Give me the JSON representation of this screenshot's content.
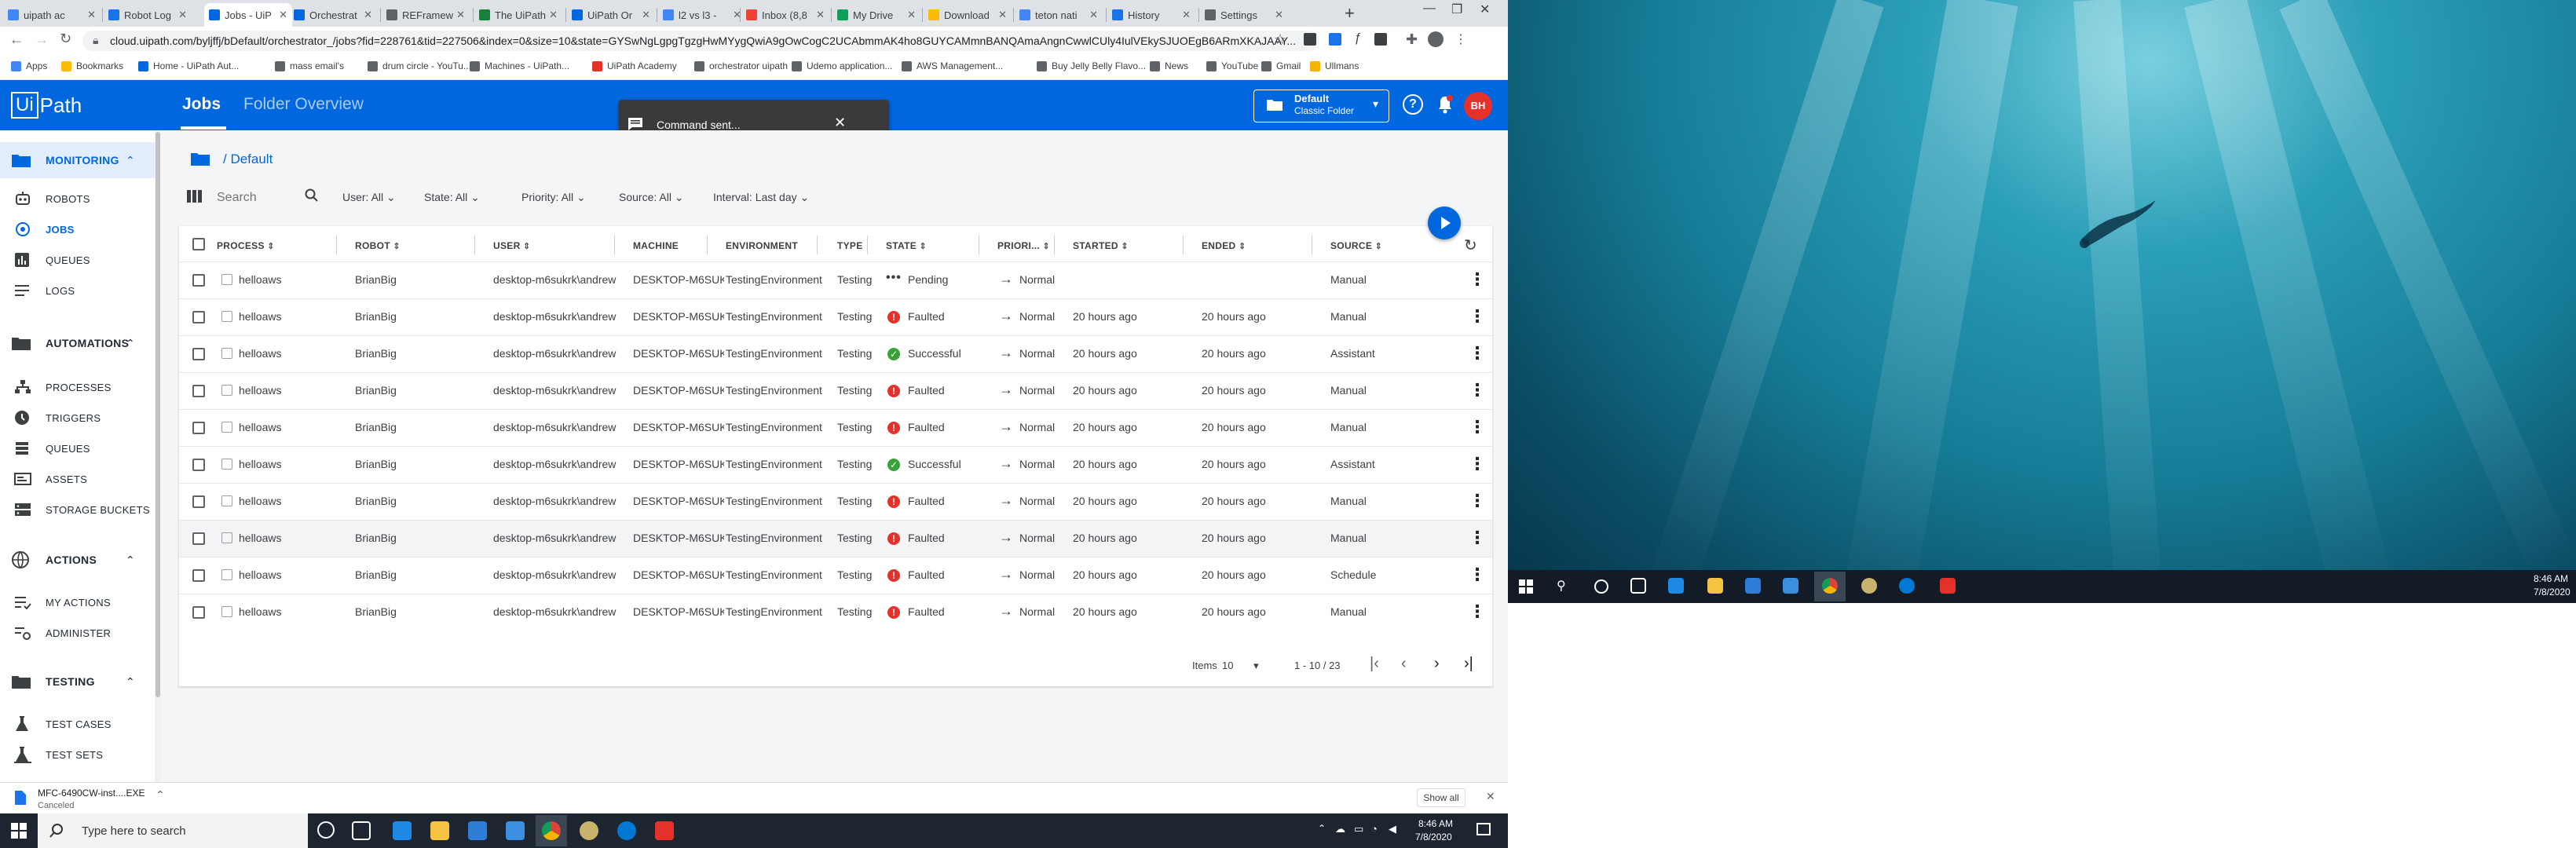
{
  "browser": {
    "tabs": [
      {
        "title": "uipath ac"
      },
      {
        "title": "Robot Log"
      },
      {
        "title": "Jobs - UiP"
      },
      {
        "title": "Orchestrat"
      },
      {
        "title": "REFramew"
      },
      {
        "title": "The UiPath"
      },
      {
        "title": "UiPath Or"
      },
      {
        "title": "l2 vs l3 - "
      },
      {
        "title": "Inbox (8,8"
      },
      {
        "title": "My Drive"
      },
      {
        "title": "Download"
      },
      {
        "title": "teton nati"
      },
      {
        "title": "History"
      },
      {
        "title": "Settings"
      }
    ],
    "new_tab": "+",
    "url": "cloud.uipath.com/byljffj/bDefault/orchestrator_/jobs?fid=228761&tid=227506&index=0&size=10&state=GYSwNgLgpgTgzgHwMYygQwiA9gOwCogC2UCAbmmAK4ho8GUYCAMmnBANQAmaAngnCwwlCUly4IulVEkySJUOEgB6ARmXKAJAAY...",
    "bookmarks": [
      "Apps",
      "Bookmarks",
      "Home - UiPath Aut...",
      "mass email's",
      "drum circle - YouTu...",
      "Machines - UiPath...",
      "UiPath Academy",
      "orchestrator uipath",
      "Udemo application...",
      "AWS Management...",
      "Buy Jelly Belly Flavo...",
      "News",
      "YouTube",
      "Gmail",
      "Ullmans"
    ]
  },
  "header": {
    "logo_ui": "Ui",
    "logo_path": "Path",
    "tabs": [
      "Jobs",
      "Folder Overview"
    ],
    "folder_name": "Default",
    "folder_type": "Classic Folder",
    "avatar_initials": "BH",
    "toast": "Command sent..."
  },
  "sidebar": {
    "monitoring": {
      "label": "MONITORING",
      "items": [
        "ROBOTS",
        "JOBS",
        "QUEUES",
        "LOGS"
      ]
    },
    "automations": {
      "label": "AUTOMATIONS",
      "items": [
        "PROCESSES",
        "TRIGGERS",
        "QUEUES",
        "ASSETS",
        "STORAGE BUCKETS"
      ]
    },
    "actions": {
      "label": "ACTIONS",
      "items": [
        "MY ACTIONS",
        "ADMINISTER"
      ]
    },
    "testing": {
      "label": "TESTING",
      "items": [
        "TEST CASES",
        "TEST SETS"
      ]
    }
  },
  "content": {
    "breadcrumb": "/ Default",
    "search_placeholder": "Search",
    "filters": [
      "User: All",
      "State: All",
      "Priority: All",
      "Source: All",
      "Interval: Last day"
    ]
  },
  "table": {
    "columns": [
      "PROCESS",
      "ROBOT",
      "USER",
      "MACHINE",
      "ENVIRONMENT",
      "TYPE",
      "STATE",
      "PRIORI...",
      "STARTED",
      "ENDED",
      "SOURCE"
    ],
    "rows": [
      {
        "process": "helloaws",
        "robot": "BrianBig",
        "user": "desktop-m6sukrk\\andrew",
        "machine": "DESKTOP-M6SUK...",
        "environment": "TestingEnvironment",
        "type": "Testing",
        "state": "Pending",
        "priority": "Normal",
        "started": "",
        "ended": "",
        "source": "Manual"
      },
      {
        "process": "helloaws",
        "robot": "BrianBig",
        "user": "desktop-m6sukrk\\andrew",
        "machine": "DESKTOP-M6SUK...",
        "environment": "TestingEnvironment",
        "type": "Testing",
        "state": "Faulted",
        "priority": "Normal",
        "started": "20 hours ago",
        "ended": "20 hours ago",
        "source": "Manual"
      },
      {
        "process": "helloaws",
        "robot": "BrianBig",
        "user": "desktop-m6sukrk\\andrew",
        "machine": "DESKTOP-M6SUK...",
        "environment": "TestingEnvironment",
        "type": "Testing",
        "state": "Successful",
        "priority": "Normal",
        "started": "20 hours ago",
        "ended": "20 hours ago",
        "source": "Assistant"
      },
      {
        "process": "helloaws",
        "robot": "BrianBig",
        "user": "desktop-m6sukrk\\andrew",
        "machine": "DESKTOP-M6SUK...",
        "environment": "TestingEnvironment",
        "type": "Testing",
        "state": "Faulted",
        "priority": "Normal",
        "started": "20 hours ago",
        "ended": "20 hours ago",
        "source": "Manual"
      },
      {
        "process": "helloaws",
        "robot": "BrianBig",
        "user": "desktop-m6sukrk\\andrew",
        "machine": "DESKTOP-M6SUK...",
        "environment": "TestingEnvironment",
        "type": "Testing",
        "state": "Faulted",
        "priority": "Normal",
        "started": "20 hours ago",
        "ended": "20 hours ago",
        "source": "Manual"
      },
      {
        "process": "helloaws",
        "robot": "BrianBig",
        "user": "desktop-m6sukrk\\andrew",
        "machine": "DESKTOP-M6SUK...",
        "environment": "TestingEnvironment",
        "type": "Testing",
        "state": "Successful",
        "priority": "Normal",
        "started": "20 hours ago",
        "ended": "20 hours ago",
        "source": "Assistant"
      },
      {
        "process": "helloaws",
        "robot": "BrianBig",
        "user": "desktop-m6sukrk\\andrew",
        "machine": "DESKTOP-M6SUK...",
        "environment": "TestingEnvironment",
        "type": "Testing",
        "state": "Faulted",
        "priority": "Normal",
        "started": "20 hours ago",
        "ended": "20 hours ago",
        "source": "Manual"
      },
      {
        "process": "helloaws",
        "robot": "BrianBig",
        "user": "desktop-m6sukrk\\andrew",
        "machine": "DESKTOP-M6SUK...",
        "environment": "TestingEnvironment",
        "type": "Testing",
        "state": "Faulted",
        "priority": "Normal",
        "started": "20 hours ago",
        "ended": "20 hours ago",
        "source": "Manual"
      },
      {
        "process": "helloaws",
        "robot": "BrianBig",
        "user": "desktop-m6sukrk\\andrew",
        "machine": "DESKTOP-M6SUK...",
        "environment": "TestingEnvironment",
        "type": "Testing",
        "state": "Faulted",
        "priority": "Normal",
        "started": "20 hours ago",
        "ended": "20 hours ago",
        "source": "Schedule"
      },
      {
        "process": "helloaws",
        "robot": "BrianBig",
        "user": "desktop-m6sukrk\\andrew",
        "machine": "DESKTOP-M6SUK...",
        "environment": "TestingEnvironment",
        "type": "Testing",
        "state": "Faulted",
        "priority": "Normal",
        "started": "20 hours ago",
        "ended": "20 hours ago",
        "source": "Manual"
      }
    ]
  },
  "pagination": {
    "items_label": "Items",
    "page_size": "10",
    "range": "1 - 10 / 23"
  },
  "download_bar": {
    "filename": "MFC-6490CW-inst....EXE",
    "status": "Canceled",
    "show_all": "Show all"
  },
  "taskbar": {
    "search_placeholder": "Type here to search",
    "left_time": "8:46 AM",
    "left_date": "7/8/2020",
    "right_time": "8:46 AM",
    "right_date": "7/8/2020"
  },
  "colors": {
    "brand_blue": "#0067df",
    "faulted": "#e4312a",
    "successful": "#38a238",
    "avatar": "#e4312a"
  }
}
